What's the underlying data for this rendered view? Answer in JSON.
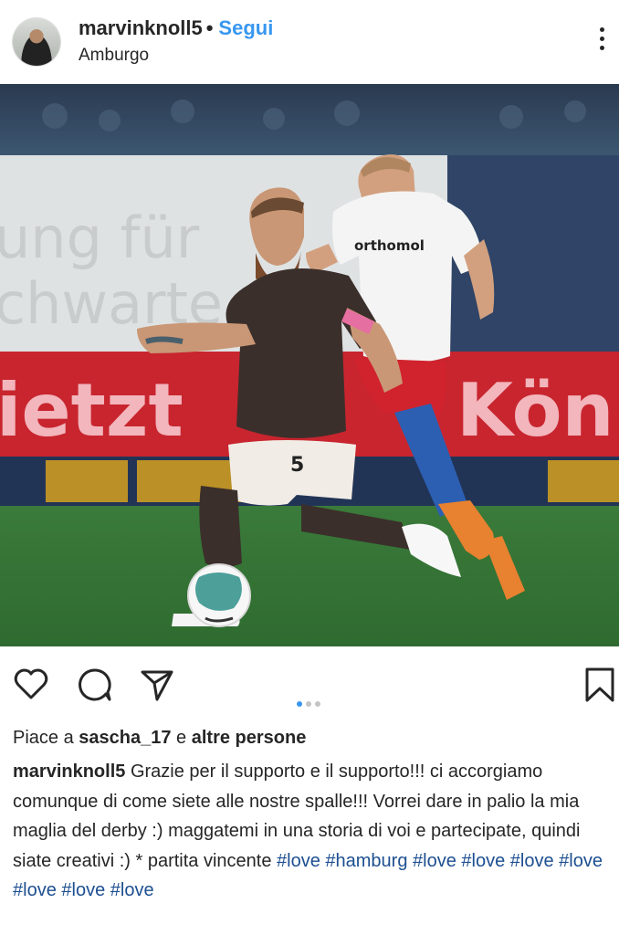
{
  "header": {
    "username": "marvinknoll5",
    "separator": "•",
    "follow_label": "Segui",
    "location": "Amburgo",
    "more_icon": "more-vertical-icon"
  },
  "post": {
    "image_description_icons": [
      "soccer-ball"
    ],
    "billboard_texts": [
      "ung für",
      "chwarte",
      "ietzt",
      "Kön"
    ],
    "jersey_sponsor": "orthomol",
    "jersey_number": "5"
  },
  "actions": {
    "icons": [
      "heart-icon",
      "comment-icon",
      "share-icon",
      "bookmark-icon"
    ],
    "carousel": {
      "count": 3,
      "active_index": 0
    },
    "accent_color": "#3897f0"
  },
  "likes": {
    "prefix": "Piace a",
    "user": "sascha_17",
    "conjunction": "e",
    "others": "altre persone"
  },
  "caption": {
    "user": "marvinknoll5",
    "text": "Grazie per il supporto e il supporto!!! ci accorgiamo comunque di come siete alle nostre spalle!!! Vorrei dare in palio la mia maglia del derby :) maggatemi in una storia di voi e partecipate, quindi siate creativi :) * partita vincente",
    "hashtags": [
      "#love",
      "#hamburg",
      "#love",
      "#love",
      "#love",
      "#love",
      "#love",
      "#love",
      "#love"
    ],
    "hashtag_color": "#1d4f91"
  }
}
